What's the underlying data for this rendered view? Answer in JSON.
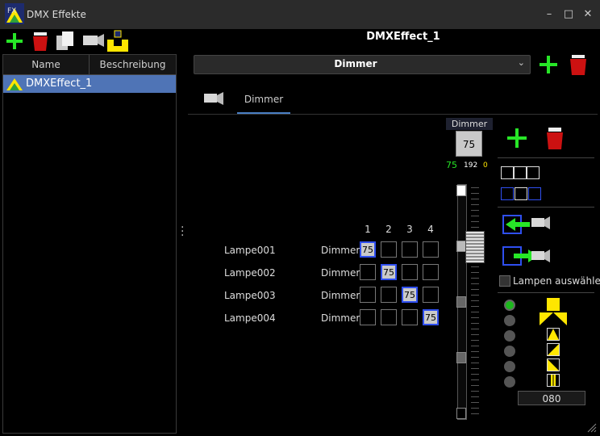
{
  "window": {
    "title": "DMX Effekte",
    "minimize": "–",
    "maximize": "□",
    "close": "✕"
  },
  "header": {
    "effect_title": "DMXEffect_1"
  },
  "left": {
    "columns": [
      "Name",
      "Beschreibung"
    ],
    "rows": [
      {
        "name": "DMXEffect_1"
      }
    ]
  },
  "effect_type": {
    "selected": "Dimmer"
  },
  "tabs": [
    {
      "label": ""
    },
    {
      "label": "Dimmer"
    }
  ],
  "matrix": {
    "columns": [
      "1",
      "2",
      "3",
      "4"
    ],
    "lamps": [
      {
        "name": "Lampe001",
        "channel": "Dimmer",
        "active_col": 0,
        "value": "75"
      },
      {
        "name": "Lampe002",
        "channel": "Dimmer",
        "active_col": 1,
        "value": "75"
      },
      {
        "name": "Lampe003",
        "channel": "Dimmer",
        "active_col": 2,
        "value": "75"
      },
      {
        "name": "Lampe004",
        "channel": "Dimmer",
        "active_col": 3,
        "value": "75"
      }
    ]
  },
  "dimmer": {
    "label": "Dimmer",
    "value": "75",
    "percent": "75",
    "dmx": "192",
    "offset": "0",
    "level_fraction": 0.75
  },
  "options": {
    "select_lamps": "Lampen auswählen",
    "number": "080"
  },
  "colors": {
    "accent": "#4f74b6",
    "add": "#27e627",
    "delete": "#cc1111",
    "yellow": "#ffe600",
    "cell_border": "#2f4ff0"
  }
}
